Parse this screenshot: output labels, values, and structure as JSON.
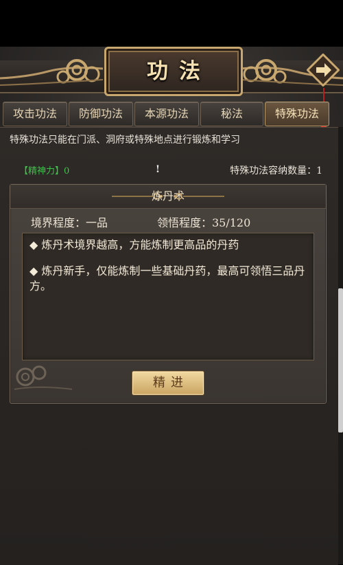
{
  "header": {
    "title": "功法",
    "next_icon": "arrow-right-icon"
  },
  "tabs": [
    {
      "label": "攻击功法",
      "active": false
    },
    {
      "label": "防御功法",
      "active": false
    },
    {
      "label": "本源功法",
      "active": false
    },
    {
      "label": "秘法",
      "active": false
    },
    {
      "label": "特殊功法",
      "active": true
    }
  ],
  "notice": "特殊功法只能在门派、洞府或特殊地点进行锻炼和学习",
  "spirit": {
    "label": "【精神力】",
    "value": "0"
  },
  "warning_icon": "!",
  "capacity": "特殊功法容纳数量：1",
  "skill": {
    "name": "炼丹术",
    "realm": "境界程度：一品",
    "comprehension": "领悟程度：35/120",
    "descriptions": [
      "◆ 炼丹术境界越高，方能炼制更高品的丹药",
      "◆ 炼丹新手，仅能炼制一些基础丹药，最高可领悟三品丹方。"
    ],
    "button_label": "精进"
  },
  "colors": {
    "accent_gold": "#c9a870",
    "spirit_green": "#3ec24a",
    "button_gold": "#e0c080"
  }
}
